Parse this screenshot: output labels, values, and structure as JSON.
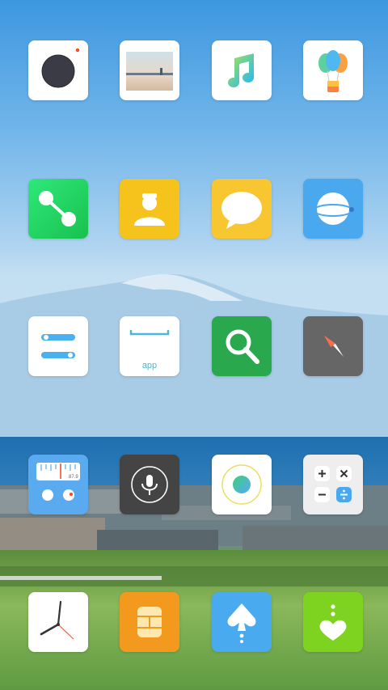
{
  "home_screen": {
    "wallpaper": "mountain-coastal-village",
    "icons": [
      {
        "name": "camera-app-icon",
        "color": "#ffffff"
      },
      {
        "name": "gallery-app-icon",
        "color": "#ffffff"
      },
      {
        "name": "music-app-icon",
        "color": "#ffffff"
      },
      {
        "name": "balloon-app-icon",
        "color": "#ffffff"
      },
      {
        "name": "phone-app-icon",
        "color": "#22cc55"
      },
      {
        "name": "contacts-app-icon",
        "color": "#f6c21c"
      },
      {
        "name": "messages-app-icon",
        "color": "#f6c21c"
      },
      {
        "name": "browser-app-icon",
        "color": "#4aa8ee"
      },
      {
        "name": "settings-app-icon",
        "color": "#ffffff"
      },
      {
        "name": "app-store-icon",
        "color": "#ffffff",
        "label": "app"
      },
      {
        "name": "search-app-icon",
        "color": "#2aa84e"
      },
      {
        "name": "compass-app-icon",
        "color": "#666666"
      },
      {
        "name": "radio-app-icon",
        "color": "#5aaaf0",
        "label": "87.9"
      },
      {
        "name": "voice-recorder-app-icon",
        "color": "#444444"
      },
      {
        "name": "assistant-app-icon",
        "color": "#ffffff"
      },
      {
        "name": "calculator-app-icon",
        "color": "#eeeeee"
      },
      {
        "name": "clock-app-icon",
        "color": "#ffffff"
      },
      {
        "name": "sim-toolkit-app-icon",
        "color": "#f39a1e"
      },
      {
        "name": "cloud-app-icon",
        "color": "#4aaaf0"
      },
      {
        "name": "health-app-icon",
        "color": "#7ed321"
      }
    ]
  }
}
